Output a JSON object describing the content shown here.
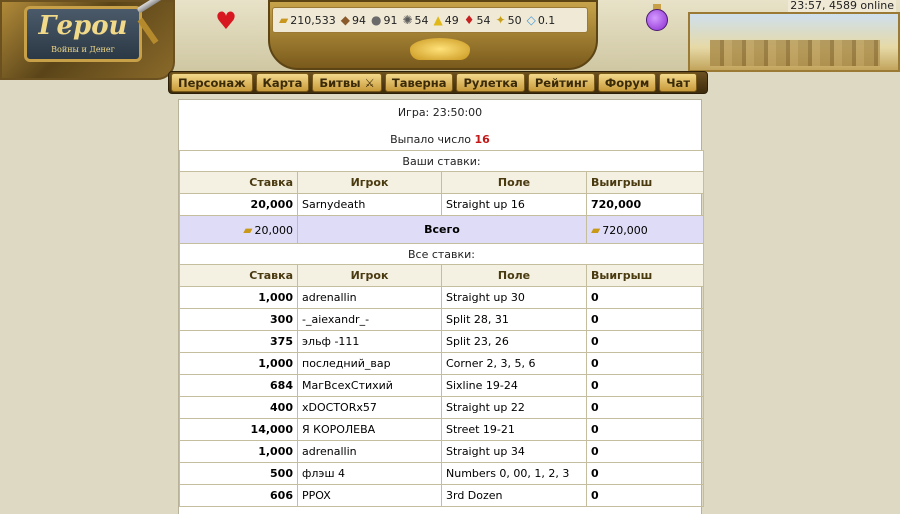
{
  "header": {
    "logo_title": "Герои",
    "logo_subtitle": "Войны и Денег",
    "clock": "23:57, 4589 online",
    "resources": [
      {
        "icon": "gold-icon",
        "glyph": "▰",
        "color": "#c9961e",
        "value": "210,533"
      },
      {
        "icon": "wood-icon",
        "glyph": "◆",
        "color": "#8a5a2a",
        "value": "94"
      },
      {
        "icon": "ore-icon",
        "glyph": "●",
        "color": "#6a6a6a",
        "value": "91"
      },
      {
        "icon": "mercury-icon",
        "glyph": "✺",
        "color": "#5a5a5a",
        "value": "54"
      },
      {
        "icon": "sulfur-icon",
        "glyph": "▲",
        "color": "#e0b818",
        "value": "49"
      },
      {
        "icon": "crystal-icon",
        "glyph": "♦",
        "color": "#c82020",
        "value": "54"
      },
      {
        "icon": "gems-icon",
        "glyph": "✦",
        "color": "#c8a018",
        "value": "50"
      },
      {
        "icon": "diamond-icon",
        "glyph": "◇",
        "color": "#4a9ad8",
        "value": "0.1"
      }
    ]
  },
  "nav": [
    {
      "label": "Персонаж",
      "name": "nav-character"
    },
    {
      "label": "Карта",
      "name": "nav-map"
    },
    {
      "label": "Битвы ⚔",
      "name": "nav-battles"
    },
    {
      "label": "Таверна",
      "name": "nav-tavern"
    },
    {
      "label": "Рулетка",
      "name": "nav-roulette"
    },
    {
      "label": "Рейтинг",
      "name": "nav-rating"
    },
    {
      "label": "Форум",
      "name": "nav-forum"
    },
    {
      "label": "Чат",
      "name": "nav-chat"
    }
  ],
  "game": {
    "time_text": "Игра: 23:50:00",
    "dropped_label": "Выпало число",
    "dropped_number": "16"
  },
  "your_bets": {
    "title": "Ваши ставки:",
    "columns": [
      "Ставка",
      "Игрок",
      "Поле",
      "Выигрыш"
    ],
    "rows": [
      {
        "stake": "20,000",
        "player": "Sarnydeath",
        "field": "Straight up 16",
        "win": "720,000"
      }
    ],
    "total": {
      "stake": "20,000",
      "label": "Всего",
      "win": "720,000"
    }
  },
  "all_bets": {
    "title": "Все ставки:",
    "columns": [
      "Ставка",
      "Игрок",
      "Поле",
      "Выигрыш"
    ],
    "rows": [
      {
        "stake": "1,000",
        "player": "adrenallin",
        "field": "Straight up 30",
        "win": "0"
      },
      {
        "stake": "300",
        "player": "-_aiexandr_-",
        "field": "Split 28, 31",
        "win": "0"
      },
      {
        "stake": "375",
        "player": "эльф -111",
        "field": "Split 23, 26",
        "win": "0"
      },
      {
        "stake": "1,000",
        "player": "последний_вар",
        "field": "Corner 2, 3, 5, 6",
        "win": "0"
      },
      {
        "stake": "684",
        "player": "МагВсехСтихий",
        "field": "Sixline 19-24",
        "win": "0"
      },
      {
        "stake": "400",
        "player": "xDOCTORx57",
        "field": "Straight up 22",
        "win": "0"
      },
      {
        "stake": "14,000",
        "player": "Я КОРОЛЕВА",
        "field": "Street 19-21",
        "win": "0"
      },
      {
        "stake": "1,000",
        "player": "adrenallin",
        "field": "Straight up 34",
        "win": "0"
      },
      {
        "stake": "500",
        "player": "флэш 4",
        "field": "Numbers 0, 00, 1, 2, 3",
        "win": "0"
      },
      {
        "stake": "606",
        "player": "PPOX",
        "field": "3rd Dozen",
        "win": "0"
      }
    ]
  }
}
